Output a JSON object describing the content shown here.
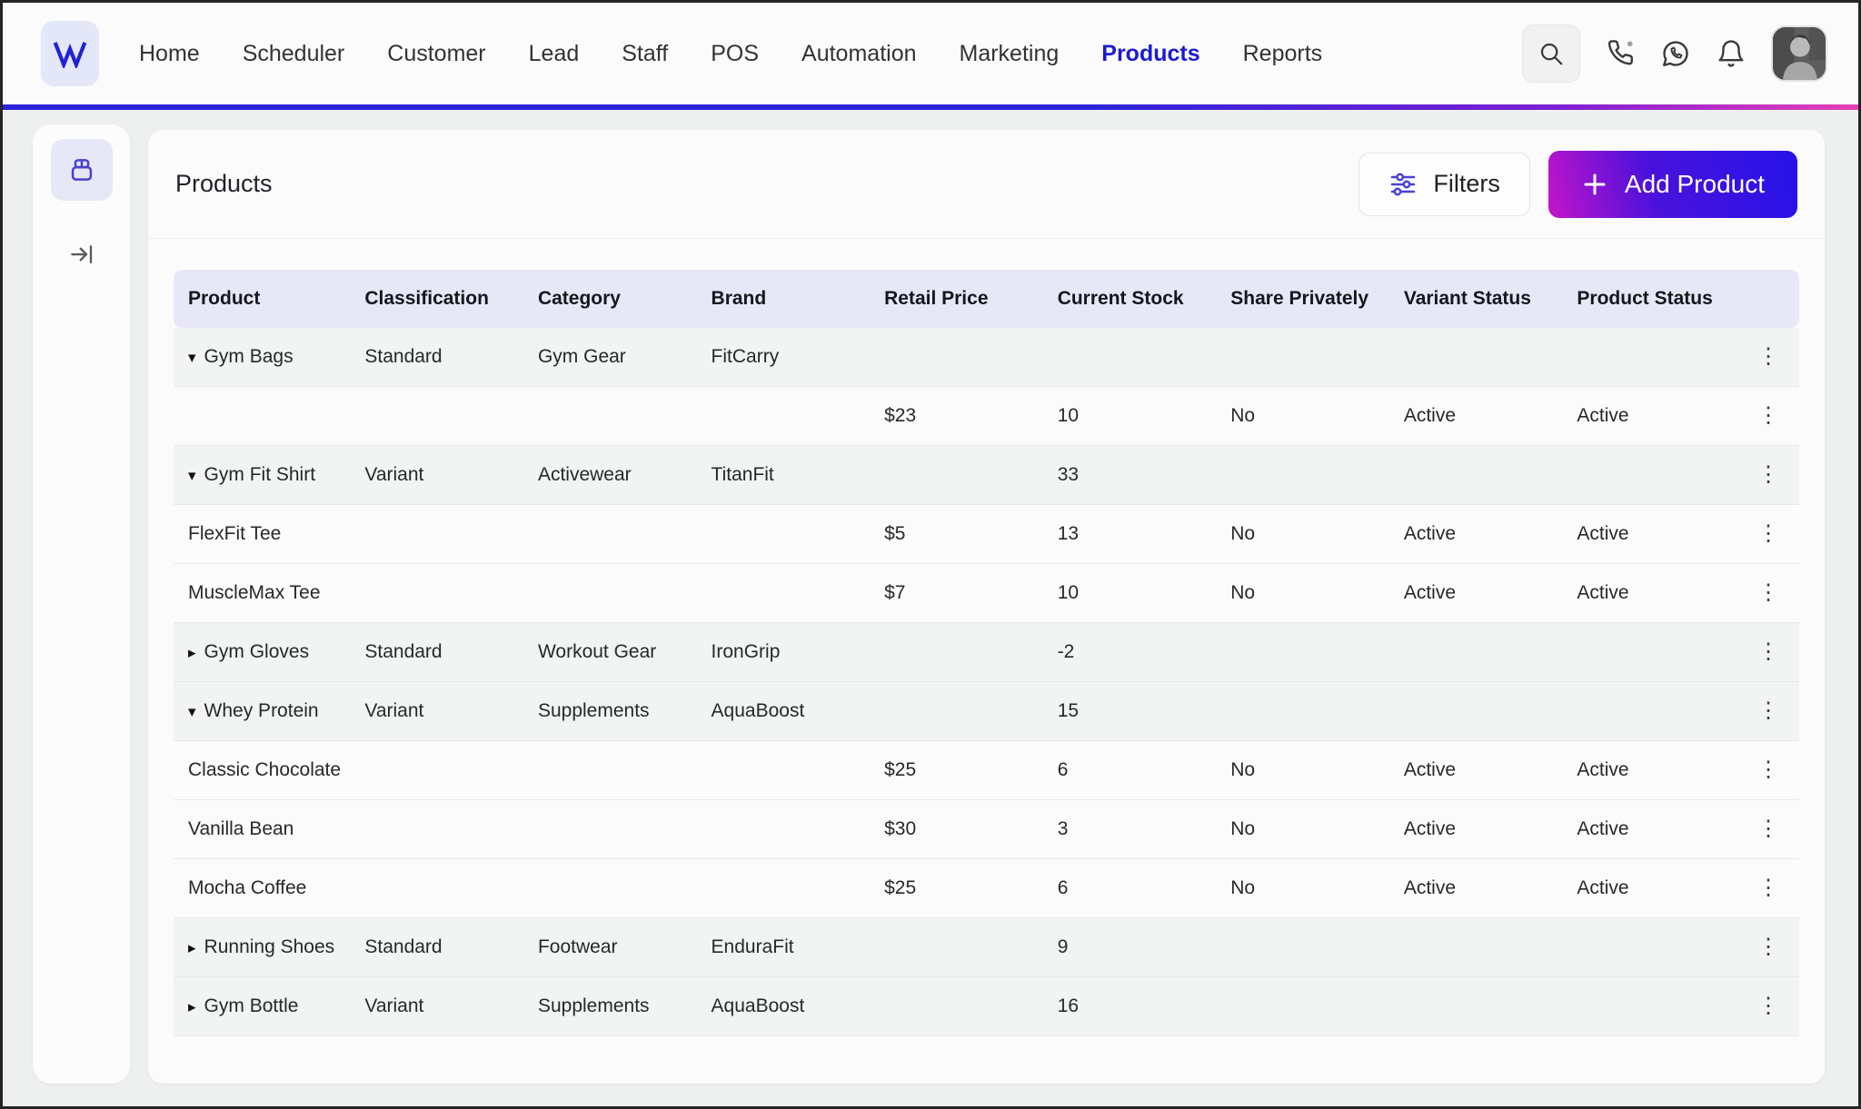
{
  "nav": {
    "logo_letter": "W",
    "items": [
      {
        "label": "Home",
        "active": false
      },
      {
        "label": "Scheduler",
        "active": false
      },
      {
        "label": "Customer",
        "active": false
      },
      {
        "label": "Lead",
        "active": false
      },
      {
        "label": "Staff",
        "active": false
      },
      {
        "label": "POS",
        "active": false
      },
      {
        "label": "Automation",
        "active": false
      },
      {
        "label": "Marketing",
        "active": false
      },
      {
        "label": "Products",
        "active": true
      },
      {
        "label": "Reports",
        "active": false
      }
    ],
    "icons": [
      "search-icon",
      "phone-icon",
      "whatsapp-icon",
      "bell-icon",
      "user-avatar"
    ]
  },
  "page": {
    "title": "Products",
    "filters_label": "Filters",
    "add_product_label": "Add Product"
  },
  "glyphs": {
    "expand_down": "▾",
    "expand_right": "▸",
    "menu": "⋮",
    "plus": "+"
  },
  "colors": {
    "accent_blue": "#1c1bd1",
    "gradient_magenta": "#c414c9",
    "gradient_blue": "#2613e9",
    "header_lavender": "#e7e7f8",
    "parent_row_bg": "#f1f4f3",
    "icon_purple": "#4a3fd8"
  },
  "table": {
    "columns": [
      "Product",
      "Classification",
      "Category",
      "Brand",
      "Retail Price",
      "Current Stock",
      "Share Privately",
      "Variant Status",
      "Product Status"
    ],
    "rows": [
      {
        "type": "parent",
        "expand": "down",
        "product": "Gym Bags",
        "classification": "Standard",
        "category": "Gym Gear",
        "brand": "FitCarry",
        "retail_price": "",
        "current_stock": "",
        "share_privately": "",
        "variant_status": "",
        "product_status": ""
      },
      {
        "type": "child",
        "expand": null,
        "product": "",
        "classification": "",
        "category": "",
        "brand": "",
        "retail_price": "$23",
        "current_stock": "10",
        "share_privately": "No",
        "variant_status": "Active",
        "product_status": "Active"
      },
      {
        "type": "parent",
        "expand": "down",
        "product": "Gym Fit Shirt",
        "classification": "Variant",
        "category": "Activewear",
        "brand": "TitanFit",
        "retail_price": "",
        "current_stock": "33",
        "share_privately": "",
        "variant_status": "",
        "product_status": ""
      },
      {
        "type": "child",
        "expand": null,
        "product": "FlexFit Tee",
        "classification": "",
        "category": "",
        "brand": "",
        "retail_price": "$5",
        "current_stock": "13",
        "share_privately": "No",
        "variant_status": "Active",
        "product_status": "Active"
      },
      {
        "type": "child",
        "expand": null,
        "product": "MuscleMax Tee",
        "classification": "",
        "category": "",
        "brand": "",
        "retail_price": "$7",
        "current_stock": "10",
        "share_privately": "No",
        "variant_status": "Active",
        "product_status": "Active"
      },
      {
        "type": "parent",
        "expand": "right",
        "product": "Gym Gloves",
        "classification": "Standard",
        "category": "Workout Gear",
        "brand": "IronGrip",
        "retail_price": "",
        "current_stock": "-2",
        "share_privately": "",
        "variant_status": "",
        "product_status": ""
      },
      {
        "type": "parent",
        "expand": "down",
        "product": "Whey Protein",
        "classification": "Variant",
        "category": "Supplements",
        "brand": "AquaBoost",
        "retail_price": "",
        "current_stock": "15",
        "share_privately": "",
        "variant_status": "",
        "product_status": ""
      },
      {
        "type": "child",
        "expand": null,
        "product": "Classic Chocolate",
        "classification": "",
        "category": "",
        "brand": "",
        "retail_price": "$25",
        "current_stock": "6",
        "share_privately": "No",
        "variant_status": "Active",
        "product_status": "Active"
      },
      {
        "type": "child",
        "expand": null,
        "product": "Vanilla Bean",
        "classification": "",
        "category": "",
        "brand": "",
        "retail_price": "$30",
        "current_stock": "3",
        "share_privately": "No",
        "variant_status": "Active",
        "product_status": "Active"
      },
      {
        "type": "child",
        "expand": null,
        "product": "Mocha Coffee",
        "classification": "",
        "category": "",
        "brand": "",
        "retail_price": "$25",
        "current_stock": "6",
        "share_privately": "No",
        "variant_status": "Active",
        "product_status": "Active"
      },
      {
        "type": "parent",
        "expand": "right",
        "product": "Running Shoes",
        "classification": "Standard",
        "category": "Footwear",
        "brand": "EnduraFit",
        "retail_price": "",
        "current_stock": "9",
        "share_privately": "",
        "variant_status": "",
        "product_status": ""
      },
      {
        "type": "parent",
        "expand": "right",
        "product": "Gym Bottle",
        "classification": "Variant",
        "category": "Supplements",
        "brand": "AquaBoost",
        "retail_price": "",
        "current_stock": "16",
        "share_privately": "",
        "variant_status": "",
        "product_status": ""
      }
    ]
  }
}
